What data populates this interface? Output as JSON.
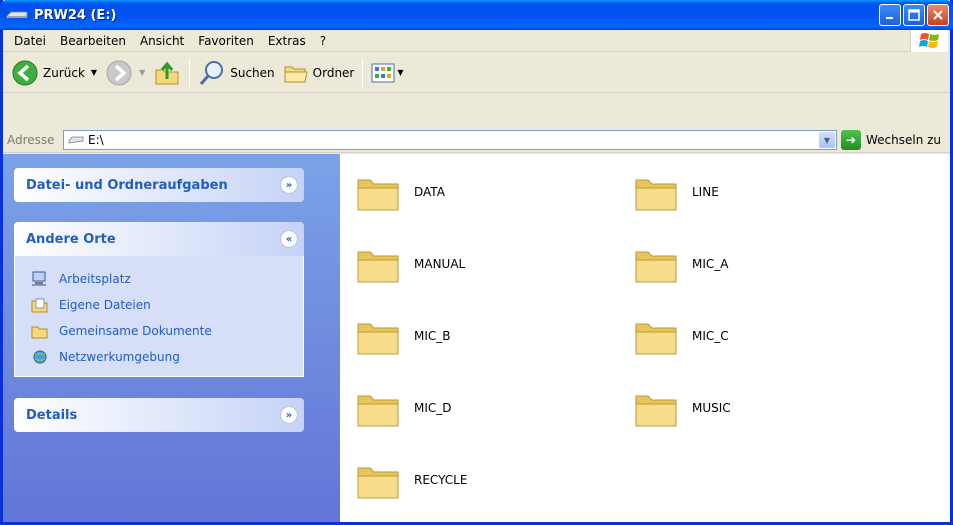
{
  "window": {
    "title": "PRW24 (E:)"
  },
  "menu": [
    "Datei",
    "Bearbeiten",
    "Ansicht",
    "Favoriten",
    "Extras",
    "?"
  ],
  "toolbar": {
    "back_label": "Zurück",
    "search_label": "Suchen",
    "folders_label": "Ordner"
  },
  "address": {
    "label": "Adresse",
    "value": "E:\\",
    "go_label": "Wechseln zu"
  },
  "leftpane": {
    "tasks_title": "Datei- und Ordneraufgaben",
    "other_title": "Andere Orte",
    "other_links": [
      "Arbeitsplatz",
      "Eigene Dateien",
      "Gemeinsame Dokumente",
      "Netzwerkumgebung"
    ],
    "details_title": "Details"
  },
  "folders": [
    "DATA",
    "LINE",
    "MANUAL",
    "MIC_A",
    "MIC_B",
    "MIC_C",
    "MIC_D",
    "MUSIC",
    "RECYCLE"
  ],
  "colors": {
    "titlebar": "#0053ee",
    "leftpane": "#6f8ee0",
    "link": "#215dc6",
    "folder": "#f5d97a"
  }
}
